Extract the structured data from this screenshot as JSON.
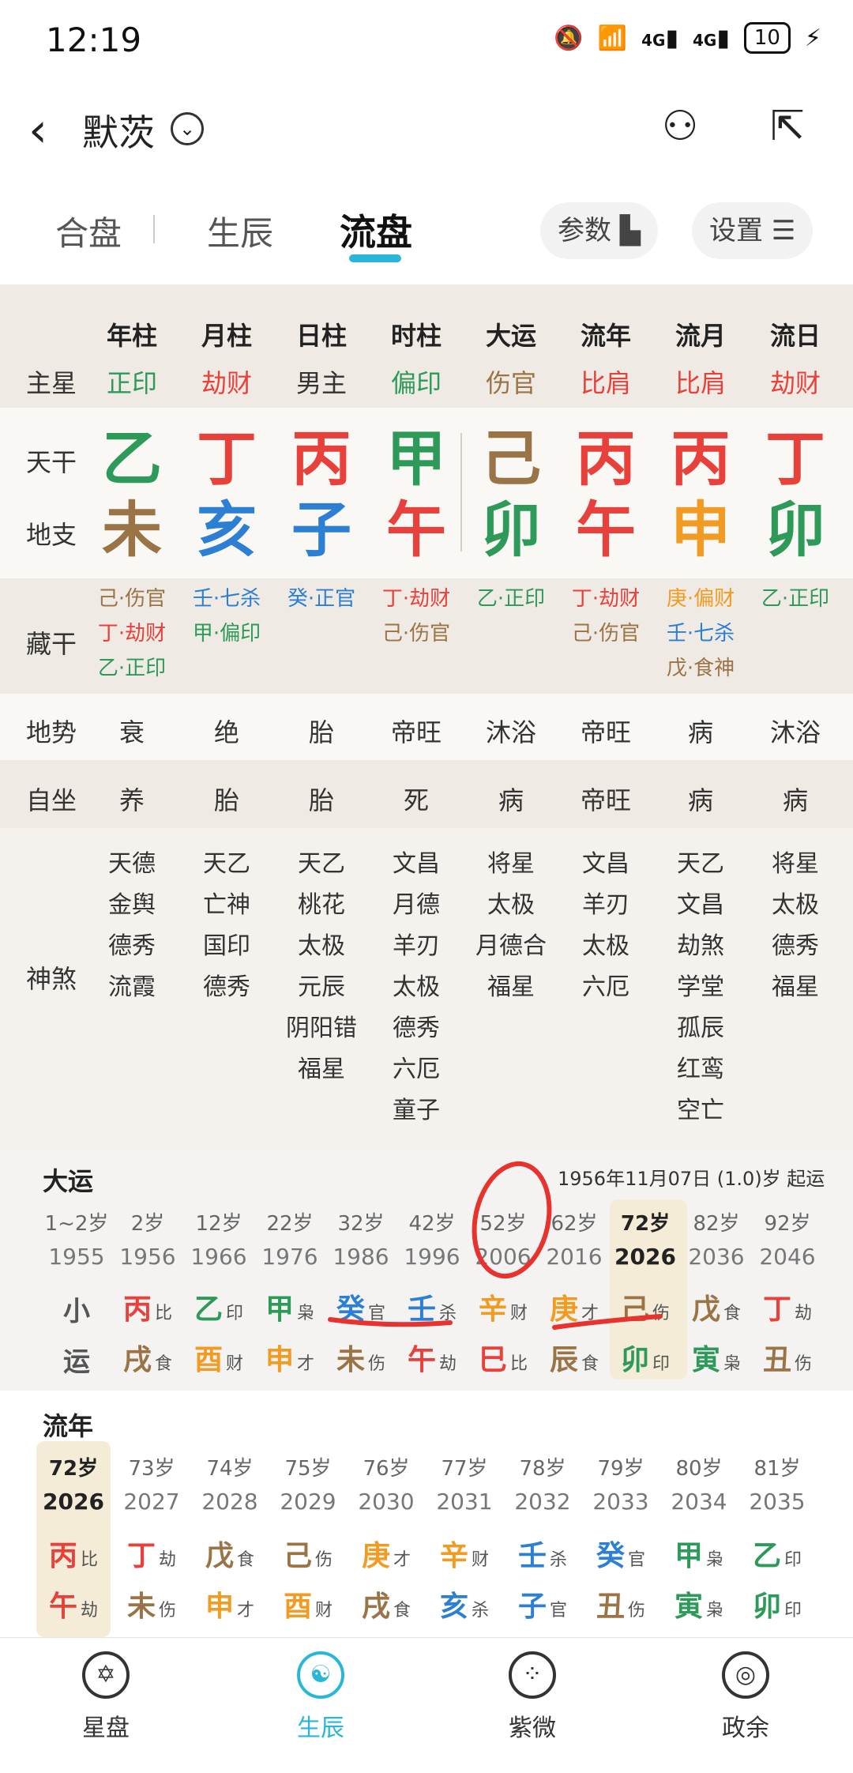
{
  "status": {
    "time": "12:19",
    "net1": "4G",
    "net2": "4G",
    "battery": "10"
  },
  "header": {
    "title": "默茨"
  },
  "tabs": [
    {
      "label": "合盘"
    },
    {
      "label": "生辰"
    },
    {
      "label": "流盘"
    }
  ],
  "pills": {
    "params": "参数",
    "settings": "设置"
  },
  "colors": {
    "green": "#2e9a5a",
    "red": "#e8403a",
    "blue": "#2d7fd3",
    "brown": "#9a7446",
    "orange": "#f19b22",
    "accent": "#29b6d8"
  },
  "chart": {
    "headers": [
      "年柱",
      "月柱",
      "日柱",
      "时柱",
      "大运",
      "流年",
      "流月",
      "流日"
    ],
    "labels": {
      "zhuxing": "主星",
      "tiangan": "天干",
      "dizhi": "地支",
      "canggan": "藏干",
      "dishi": "地势",
      "zizuo": "自坐",
      "shensha": "神煞"
    },
    "zhuxing": [
      "正印",
      "劫财",
      "男主",
      "偏印",
      "伤官",
      "比肩",
      "比肩",
      "劫财"
    ],
    "zhuxing_colors": [
      "green",
      "red",
      "dark",
      "green",
      "brown",
      "red",
      "red",
      "red"
    ],
    "tiangan": [
      "乙",
      "丁",
      "丙",
      "甲",
      "己",
      "丙",
      "丙",
      "丁"
    ],
    "tiangan_colors": [
      "green",
      "red",
      "red",
      "green",
      "brown",
      "red",
      "red",
      "red"
    ],
    "dizhi": [
      "未",
      "亥",
      "子",
      "午",
      "卯",
      "午",
      "申",
      "卯"
    ],
    "dizhi_colors": [
      "brown",
      "blue",
      "blue",
      "red",
      "green",
      "red",
      "orange",
      "green"
    ],
    "canggan": [
      [
        [
          "己·伤官",
          "brown"
        ],
        [
          "丁·劫财",
          "red"
        ],
        [
          "乙·正印",
          "green"
        ]
      ],
      [
        [
          "壬·七杀",
          "blue"
        ],
        [
          "甲·偏印",
          "green"
        ]
      ],
      [
        [
          "癸·正官",
          "blue"
        ]
      ],
      [
        [
          "丁·劫财",
          "red"
        ],
        [
          "己·伤官",
          "brown"
        ]
      ],
      [
        [
          "乙·正印",
          "green"
        ]
      ],
      [
        [
          "丁·劫财",
          "red"
        ],
        [
          "己·伤官",
          "brown"
        ]
      ],
      [
        [
          "庚·偏财",
          "orange"
        ],
        [
          "壬·七杀",
          "blue"
        ],
        [
          "戊·食神",
          "brown"
        ]
      ],
      [
        [
          "乙·正印",
          "green"
        ]
      ]
    ],
    "dishi": [
      "衰",
      "绝",
      "胎",
      "帝旺",
      "沐浴",
      "帝旺",
      "病",
      "沐浴"
    ],
    "zizuo": [
      "养",
      "胎",
      "胎",
      "死",
      "病",
      "帝旺",
      "病",
      "病"
    ],
    "shensha": [
      [
        "天德",
        "金舆",
        "德秀",
        "流霞"
      ],
      [
        "天乙",
        "亡神",
        "国印",
        "德秀"
      ],
      [
        "天乙",
        "桃花",
        "太极",
        "元辰",
        "阴阳错",
        "福星"
      ],
      [
        "文昌",
        "月德",
        "羊刃",
        "太极",
        "德秀",
        "六厄",
        "童子"
      ],
      [
        "将星",
        "太极",
        "月德合",
        "福星"
      ],
      [
        "文昌",
        "羊刃",
        "太极",
        "六厄"
      ],
      [
        "天乙",
        "文昌",
        "劫煞",
        "学堂",
        "孤辰",
        "红鸾",
        "空亡"
      ],
      [
        "将星",
        "太极",
        "德秀",
        "福星"
      ]
    ]
  },
  "dayun": {
    "title": "大运",
    "note": "1956年11月07日 (1.0)岁 起运",
    "xiao": "小",
    "yun": "运",
    "ages": [
      "1~2岁",
      "2岁",
      "12岁",
      "22岁",
      "32岁",
      "42岁",
      "52岁",
      "62岁",
      "72岁",
      "82岁",
      "92岁"
    ],
    "years": [
      "1955",
      "1956",
      "1966",
      "1976",
      "1986",
      "1996",
      "2006",
      "2016",
      "2026",
      "2036",
      "2046"
    ],
    "gan": [
      null,
      [
        "丙",
        "比",
        "red"
      ],
      [
        "乙",
        "印",
        "green"
      ],
      [
        "甲",
        "枭",
        "green"
      ],
      [
        "癸",
        "官",
        "blue"
      ],
      [
        "壬",
        "杀",
        "blue"
      ],
      [
        "辛",
        "财",
        "orange"
      ],
      [
        "庚",
        "才",
        "orange"
      ],
      [
        "己",
        "伤",
        "brown"
      ],
      [
        "戊",
        "食",
        "brown"
      ],
      [
        "丁",
        "劫",
        "red"
      ]
    ],
    "zhi": [
      null,
      [
        "戌",
        "食",
        "brown"
      ],
      [
        "酉",
        "财",
        "orange"
      ],
      [
        "申",
        "才",
        "orange"
      ],
      [
        "未",
        "伤",
        "brown"
      ],
      [
        "午",
        "劫",
        "red"
      ],
      [
        "巳",
        "比",
        "red"
      ],
      [
        "辰",
        "食",
        "brown"
      ],
      [
        "卯",
        "印",
        "green"
      ],
      [
        "寅",
        "枭",
        "green"
      ],
      [
        "丑",
        "伤",
        "brown"
      ]
    ],
    "highlight_index": 8
  },
  "liunian": {
    "title": "流年",
    "ages": [
      "72岁",
      "73岁",
      "74岁",
      "75岁",
      "76岁",
      "77岁",
      "78岁",
      "79岁",
      "80岁",
      "81岁"
    ],
    "years": [
      "2026",
      "2027",
      "2028",
      "2029",
      "2030",
      "2031",
      "2032",
      "2033",
      "2034",
      "2035"
    ],
    "gan": [
      [
        "丙",
        "比",
        "red"
      ],
      [
        "丁",
        "劫",
        "red"
      ],
      [
        "戊",
        "食",
        "brown"
      ],
      [
        "己",
        "伤",
        "brown"
      ],
      [
        "庚",
        "才",
        "orange"
      ],
      [
        "辛",
        "财",
        "orange"
      ],
      [
        "壬",
        "杀",
        "blue"
      ],
      [
        "癸",
        "官",
        "blue"
      ],
      [
        "甲",
        "枭",
        "green"
      ],
      [
        "乙",
        "印",
        "green"
      ]
    ],
    "zhi": [
      [
        "午",
        "劫",
        "red"
      ],
      [
        "未",
        "伤",
        "brown"
      ],
      [
        "申",
        "才",
        "orange"
      ],
      [
        "酉",
        "财",
        "orange"
      ],
      [
        "戌",
        "食",
        "brown"
      ],
      [
        "亥",
        "杀",
        "blue"
      ],
      [
        "子",
        "官",
        "blue"
      ],
      [
        "丑",
        "伤",
        "brown"
      ],
      [
        "寅",
        "枭",
        "green"
      ],
      [
        "卯",
        "印",
        "green"
      ]
    ],
    "highlight_index": 0
  },
  "nav": [
    {
      "label": "星盘",
      "icon": "star-of-david-icon"
    },
    {
      "label": "生辰",
      "icon": "yin-yang-icon"
    },
    {
      "label": "紫微",
      "icon": "constellation-icon"
    },
    {
      "label": "政余",
      "icon": "target-icon"
    }
  ]
}
